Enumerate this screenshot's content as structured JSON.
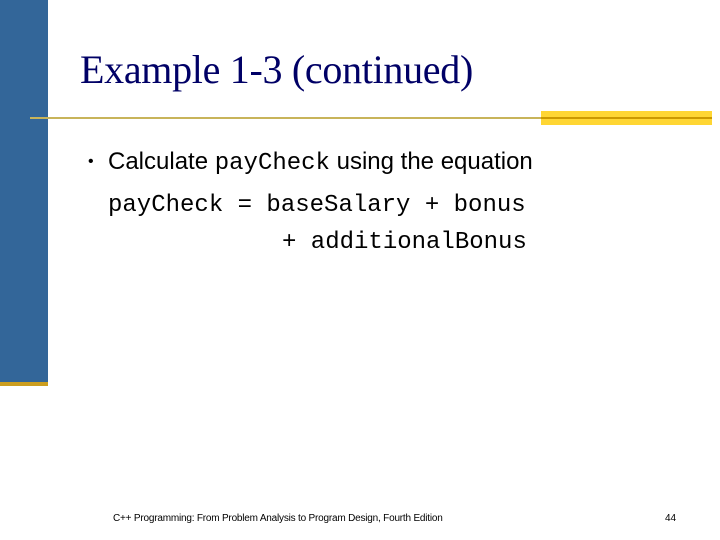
{
  "slide": {
    "title": "Example 1-3 (continued)",
    "bullets": [
      {
        "bullet_char": "•",
        "text_before": "Calculate ",
        "code": "payCheck",
        "text_after": " using the equation"
      }
    ],
    "code_lines": [
      "payCheck = baseSalary + bonus",
      "+ additionalBonus"
    ],
    "footer": "C++ Programming: From Problem Analysis to Program Design, Fourth Edition",
    "page_number": "44"
  },
  "colors": {
    "sidebar_blue": "#336699",
    "accent_gold": "#FFD633",
    "accent_dark_gold": "#CC9900",
    "title_navy": "#000066"
  }
}
